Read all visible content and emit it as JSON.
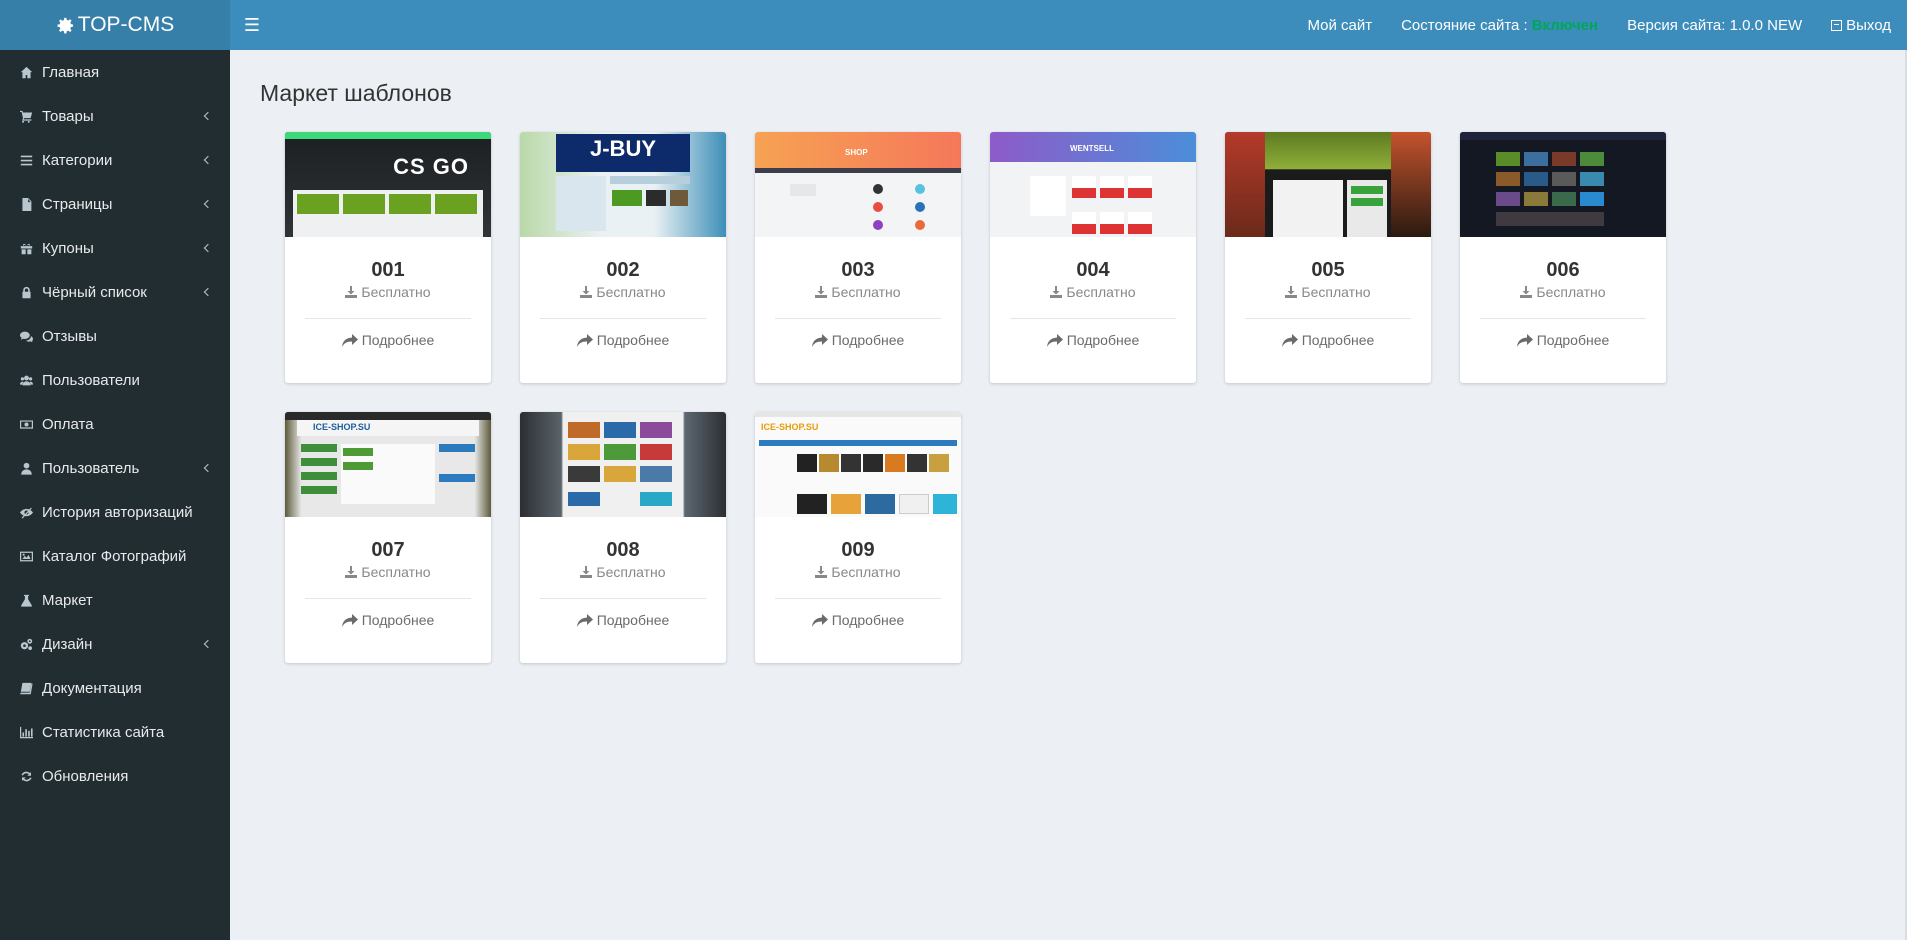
{
  "header": {
    "logo": "TOP-CMS",
    "nav": {
      "my_site": "Мой сайт",
      "status_label": "Состояние сайта :",
      "status_value": "Включен",
      "version": "Версия сайта: 1.0.0 NEW",
      "logout": "Выход"
    }
  },
  "sidebar": {
    "items": [
      {
        "label": "Главная",
        "icon": "home-icon"
      },
      {
        "label": "Товары",
        "icon": "cart-icon"
      },
      {
        "label": "Категории",
        "icon": "list-icon"
      },
      {
        "label": "Страницы",
        "icon": "file-icon"
      },
      {
        "label": "Купоны",
        "icon": "gift-icon"
      },
      {
        "label": "Чёрный список",
        "icon": "lock-icon"
      },
      {
        "label": "Отзывы",
        "icon": "comments-icon"
      },
      {
        "label": "Пользователи",
        "icon": "users-icon"
      },
      {
        "label": "Оплата",
        "icon": "money-icon"
      },
      {
        "label": "Пользователь",
        "icon": "user-icon"
      },
      {
        "label": "История авторизаций",
        "icon": "eye-slash-icon"
      },
      {
        "label": "Каталог Фотографий",
        "icon": "image-icon"
      },
      {
        "label": "Маркет",
        "icon": "flask-icon"
      },
      {
        "label": "Дизайн",
        "icon": "cogs-icon"
      },
      {
        "label": "Документация",
        "icon": "book-icon"
      },
      {
        "label": "Статистика сайта",
        "icon": "chart-icon"
      },
      {
        "label": "Обновления",
        "icon": "refresh-icon"
      }
    ]
  },
  "main": {
    "title": "Маркет шаблонов",
    "cards": [
      {
        "num": "001",
        "price": "Бесплатно",
        "link": "Подробнее",
        "thumb_text": "CS GO"
      },
      {
        "num": "002",
        "price": "Бесплатно",
        "link": "Подробнее",
        "thumb_text": "J-BUY"
      },
      {
        "num": "003",
        "price": "Бесплатно",
        "link": "Подробнее",
        "thumb_text": "SHOP"
      },
      {
        "num": "004",
        "price": "Бесплатно",
        "link": "Подробнее",
        "thumb_text": "WENTSELL"
      },
      {
        "num": "005",
        "price": "Бесплатно",
        "link": "Подробнее",
        "thumb_text": ""
      },
      {
        "num": "006",
        "price": "Бесплатно",
        "link": "Подробнее",
        "thumb_text": ""
      },
      {
        "num": "007",
        "price": "Бесплатно",
        "link": "Подробнее",
        "thumb_text": "ICE-SHOP.SU"
      },
      {
        "num": "008",
        "price": "Бесплатно",
        "link": "Подробнее",
        "thumb_text": ""
      },
      {
        "num": "009",
        "price": "Бесплатно",
        "link": "Подробнее",
        "thumb_text": "ICE-SHOP.SU"
      }
    ]
  },
  "colors": {
    "header_bg": "#3c8dbc",
    "logo_bg": "#367fa9",
    "sidebar_bg": "#222d32",
    "status_on": "#00a65a",
    "content_bg": "#ecf0f5"
  }
}
